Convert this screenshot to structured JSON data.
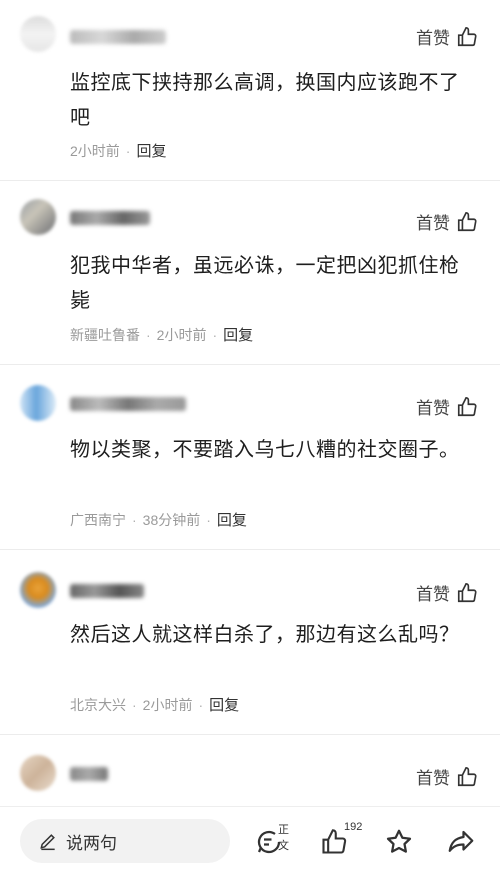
{
  "comments": [
    {
      "like_label": "首赞",
      "text": "监控底下挟持那么高调，换国内应该跑不了吧",
      "location": "",
      "time": "2小时前",
      "reply": "回复"
    },
    {
      "like_label": "首赞",
      "text": "犯我中华者，虽远必诛，一定把凶犯抓住枪毙",
      "location": "新疆吐鲁番",
      "time": "2小时前",
      "reply": "回复"
    },
    {
      "like_label": "首赞",
      "text": "物以类聚，不要踏入乌七八糟的社交圈子。",
      "location": "广西南宁",
      "time": "38分钟前",
      "reply": "回复"
    },
    {
      "like_label": "首赞",
      "text": "然后这人就这样白杀了，那边有这么乱吗？",
      "location": "北京大兴",
      "time": "2小时前",
      "reply": "回复"
    },
    {
      "like_label": "首赞"
    }
  ],
  "bottom_bar": {
    "input_placeholder": "说两句",
    "comments_badge": "正文",
    "like_count": "192"
  }
}
